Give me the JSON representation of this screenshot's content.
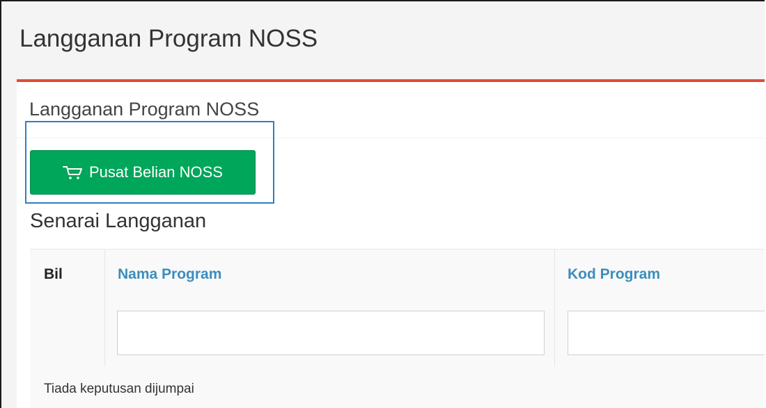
{
  "page": {
    "title": "Langganan Program NOSS"
  },
  "box": {
    "title": "Langganan Program NOSS",
    "accent_color": "#dd4b39"
  },
  "actions": {
    "shop_button_label": "Pusat Belian NOSS",
    "shop_button_icon": "shopping-cart-icon",
    "shop_button_color": "#00a65a"
  },
  "subscriptions": {
    "title": "Senarai Langganan",
    "columns": [
      "Bil",
      "Nama Program",
      "Kod Program"
    ],
    "filters": {
      "nama_program": {
        "value": "",
        "placeholder": ""
      },
      "kod_program": {
        "value": "",
        "placeholder": ""
      }
    },
    "empty_message": "Tiada keputusan dijumpai"
  }
}
